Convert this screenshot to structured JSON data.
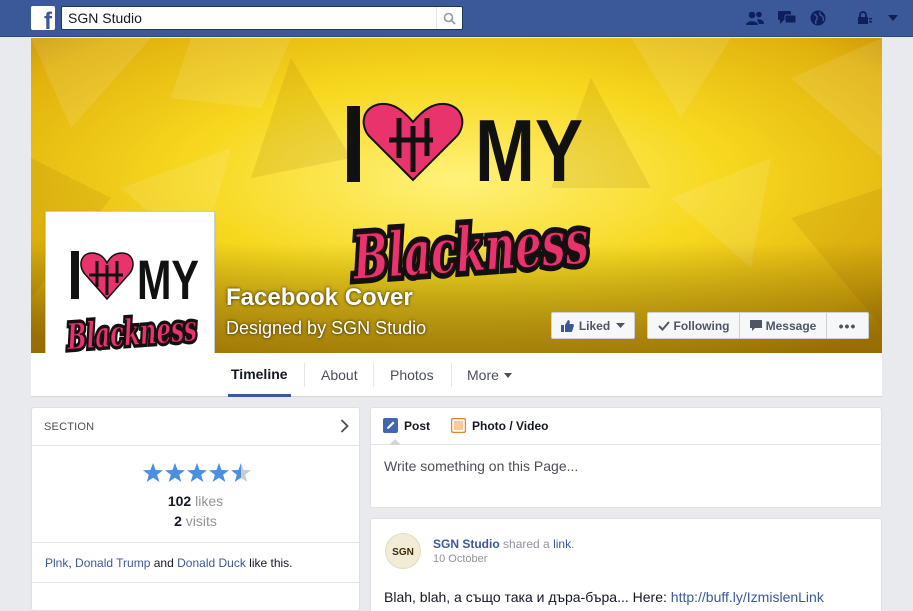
{
  "topbar": {
    "logo": "f",
    "search_value": "SGN Studio",
    "icons": [
      "friend-requests-icon",
      "messages-icon",
      "notifications-globe-icon",
      "privacy-lock-icon",
      "settings-dropdown-icon"
    ]
  },
  "cover": {
    "logo_line1_left": "I",
    "logo_line1_right": "MY",
    "logo_line2": "Blackness",
    "page_name": "Facebook Cover",
    "subtitle": "Designed by SGN Studio",
    "colors": {
      "gold": "#f5d21a",
      "pink": "#e8336d",
      "black": "#111111"
    }
  },
  "buttons": {
    "liked": "Liked",
    "following": "Following",
    "message": "Message",
    "more": "•••"
  },
  "tabs": [
    "Timeline",
    "About",
    "Photos",
    "More"
  ],
  "section": {
    "title": "SECTION",
    "rating": 4.5,
    "likes_count": "102",
    "likes_label": "likes",
    "visits_count": "2",
    "visits_label": "visits",
    "friend1": "Plnk",
    "sep1": ",",
    "friend2": "Donald Trump",
    "and": "and",
    "friend3": "Donald Duck",
    "like_this": "like this."
  },
  "composer": {
    "tab_post": "Post",
    "tab_photo": "Photo / Video",
    "placeholder": "Write something on this Page..."
  },
  "post": {
    "avatar_text": "SGN",
    "author": "SGN Studio",
    "action": "shared a",
    "object": "link",
    "period": ".",
    "date": "10 October",
    "text": "Blah, blah, а също така и дъра-бъра... Here:",
    "link": "http://buff.ly/IzmislenLink"
  }
}
